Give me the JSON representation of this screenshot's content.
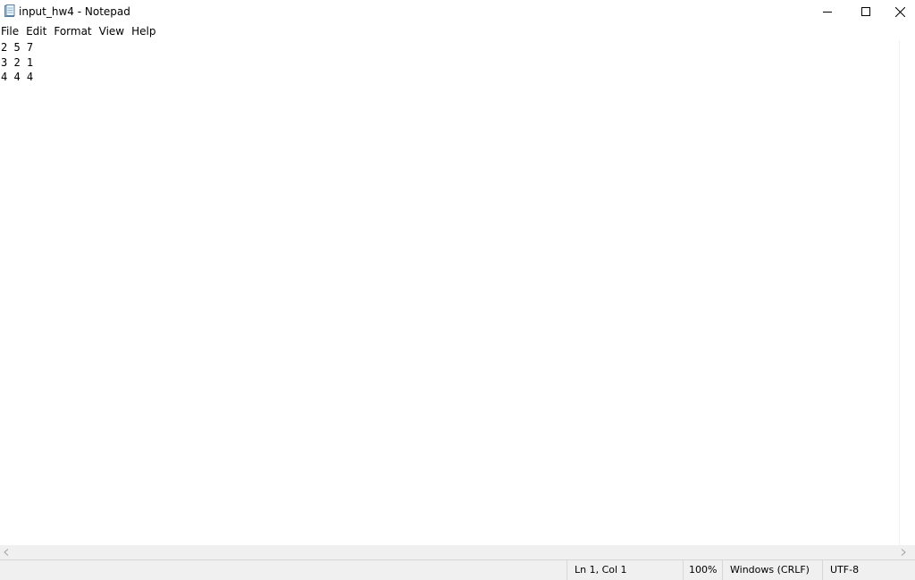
{
  "window": {
    "title": "input_hw4 - Notepad"
  },
  "icons": {
    "app": "notepad-icon",
    "minimize": "minimize-icon",
    "maximize": "maximize-icon",
    "close": "close-icon",
    "scroll_left": "chevron-left-icon",
    "scroll_right": "chevron-right-icon"
  },
  "menu": {
    "items": [
      "File",
      "Edit",
      "Format",
      "View",
      "Help"
    ]
  },
  "editor": {
    "lines": [
      "2 5 7",
      "3 2 1",
      "4 4 4"
    ]
  },
  "status": {
    "position": "Ln 1, Col 1",
    "zoom": "100%",
    "line_ending": "Windows (CRLF)",
    "encoding": "UTF-8"
  }
}
